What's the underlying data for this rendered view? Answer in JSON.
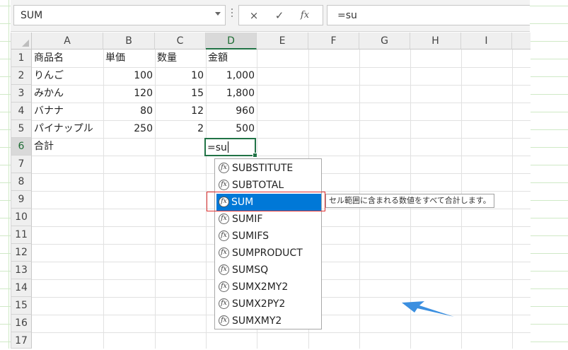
{
  "name_box": {
    "value": "SUM"
  },
  "formula_bar": {
    "cancel_icon": "×",
    "enter_icon": "✓",
    "fx_label": "fx",
    "value": "=su"
  },
  "columns": [
    "A",
    "B",
    "C",
    "D",
    "E",
    "F",
    "G",
    "H",
    "I"
  ],
  "selected_column": "D",
  "rows": [
    "1",
    "2",
    "3",
    "4",
    "5",
    "6",
    "7",
    "8",
    "9",
    "10",
    "11",
    "12",
    "13",
    "14",
    "15",
    "16",
    "17"
  ],
  "selected_row": "6",
  "cells": {
    "header": {
      "a": "商品名",
      "b": "単価",
      "c": "数量",
      "d": "金額"
    },
    "data": [
      {
        "a": "りんご",
        "b": "100",
        "c": "10",
        "d": "1,000"
      },
      {
        "a": "みかん",
        "b": "120",
        "c": "15",
        "d": "1,800"
      },
      {
        "a": "バナナ",
        "b": "80",
        "c": "12",
        "d": "960"
      },
      {
        "a": "パイナップル",
        "b": "250",
        "c": "2",
        "d": "500"
      }
    ],
    "total_label": "合計",
    "editing": "=su"
  },
  "autocomplete": {
    "items": [
      "SUBSTITUTE",
      "SUBTOTAL",
      "SUM",
      "SUMIF",
      "SUMIFS",
      "SUMPRODUCT",
      "SUMSQ",
      "SUMX2MY2",
      "SUMX2PY2",
      "SUMXMY2"
    ],
    "selected": "SUM",
    "item_icon": "fx",
    "tooltip": "セル範囲に含まれる数値をすべて合計します。"
  },
  "colors": {
    "accent": "#217346",
    "selection": "#0078d7",
    "highlight": "#e03030",
    "arrow": "#3b8fe0"
  }
}
